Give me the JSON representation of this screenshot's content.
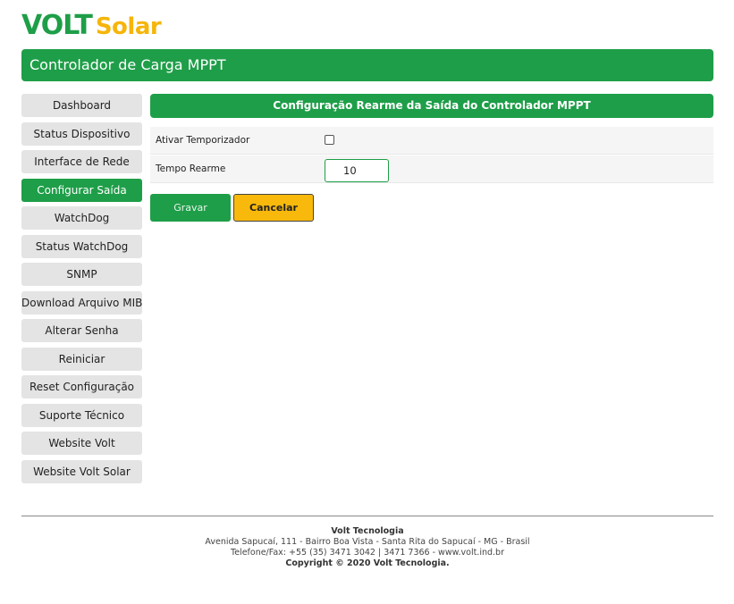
{
  "brand": {
    "volt": "VOLT",
    "solar": "Solar"
  },
  "header": {
    "title": "Controlador de Carga MPPT"
  },
  "sidebar": {
    "items": [
      {
        "label": "Dashboard"
      },
      {
        "label": "Status Dispositivo"
      },
      {
        "label": "Interface de Rede"
      },
      {
        "label": "Configurar Saída",
        "active": true
      },
      {
        "label": "WatchDog"
      },
      {
        "label": "Status WatchDog"
      },
      {
        "label": "SNMP"
      },
      {
        "label": "Download Arquivo MIB"
      },
      {
        "label": "Alterar Senha"
      },
      {
        "label": "Reiniciar"
      },
      {
        "label": "Reset Configuração"
      },
      {
        "label": "Suporte Técnico"
      },
      {
        "label": "Website Volt"
      },
      {
        "label": "Website Volt Solar"
      }
    ]
  },
  "panel": {
    "title": "Configuração Rearme da Saída do Controlador MPPT",
    "timer_label": "Ativar Temporizador",
    "timer_checked": false,
    "rearm_label": "Tempo Rearme",
    "rearm_value": "10"
  },
  "buttons": {
    "save": "Gravar",
    "cancel": "Cancelar"
  },
  "footer": {
    "company": "Volt Tecnologia",
    "address": "Avenida Sapucaí, 111 - Bairro Boa Vista - Santa Rita do Sapucaí - MG - Brasil",
    "phone": "Telefone/Fax: +55 (35) 3471 3042 | 3471 7366 - www.volt.ind.br",
    "copyright": "Copyright © 2020 Volt Tecnologia."
  },
  "colors": {
    "primary": "#1e9e48",
    "accent": "#f9b90c",
    "nav_bg": "#e4e4e4"
  }
}
